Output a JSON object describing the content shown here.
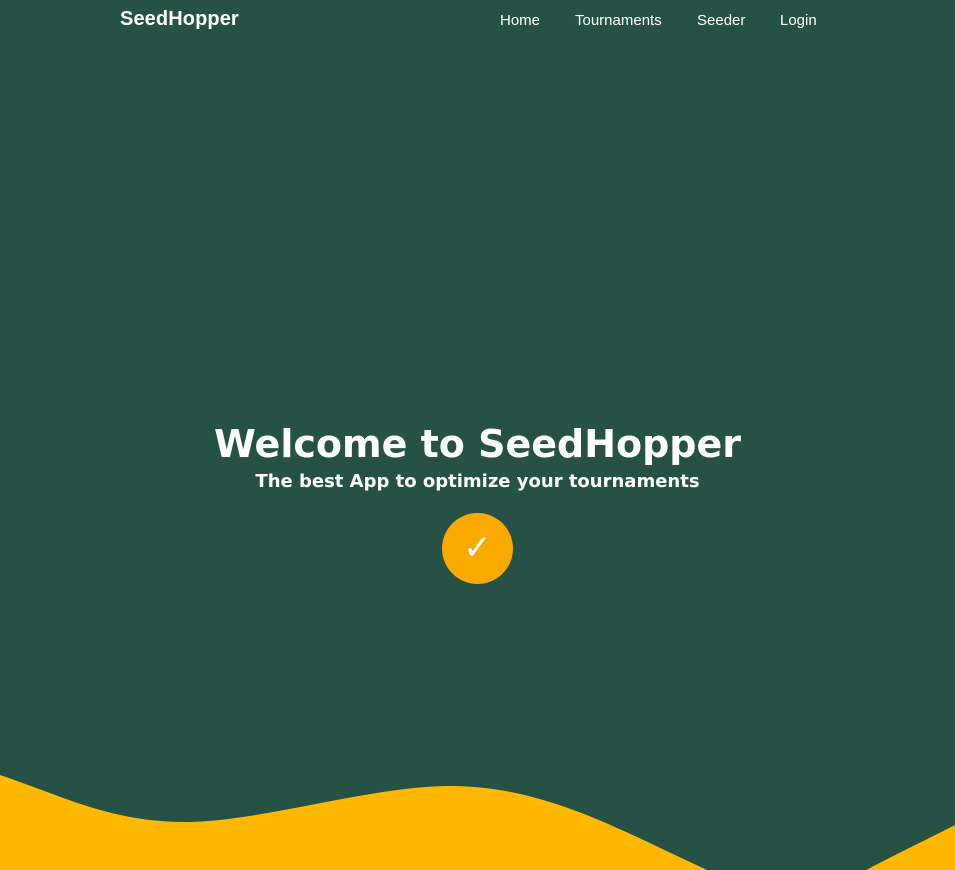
{
  "navbar": {
    "brand": "SeedHopper",
    "links": [
      {
        "label": "Home"
      },
      {
        "label": "Tournaments"
      },
      {
        "label": "Seeder"
      },
      {
        "label": "Login"
      }
    ]
  },
  "hero": {
    "title": "Welcome to SeedHopper",
    "subtitle": "The best App to optimize your tournaments",
    "cta_icon": "check-icon",
    "cta_glyph": "✓"
  },
  "colors": {
    "background": "#255245",
    "accent": "#fcaa00",
    "wave": "#ffb800",
    "text": "#ffffff"
  }
}
